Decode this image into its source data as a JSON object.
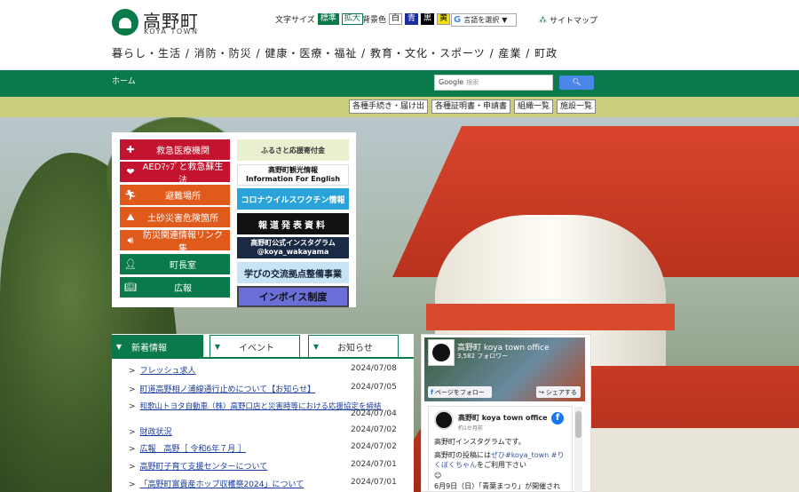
{
  "header": {
    "logo_title": "高野町",
    "logo_sub": "KOYA TOWN",
    "font_size_label": "文字サイズ",
    "font_std": "標準",
    "font_big": "拡大",
    "bg_color_label": "背景色",
    "bg_white": "白",
    "bg_blue": "青",
    "bg_black": "黒",
    "bg_yellow": "黄",
    "translate_label": "言語を選択",
    "sitemap_label": "サイトマップ",
    "nav": "暮らし・生活 / 消防・防災 / 健康・医療・福祉 / 教育・文化・スポーツ / 産業 / 町政"
  },
  "greenbar": {
    "home": "ホーム",
    "search_brand": "Google",
    "search_placeholder": "検索"
  },
  "olive_buttons": [
    "各種手続き・届け出",
    "各種証明書・申請書",
    "組織一覧",
    "施設一覧"
  ],
  "quick_links": [
    {
      "label": "救急医療機関",
      "icon": "cross-icon",
      "color": "#c4132e"
    },
    {
      "label": "AEDﾏｯﾌﾟと救急蘇生法",
      "icon": "heart-icon",
      "color": "#c4132e"
    },
    {
      "label": "避難場所",
      "icon": "running-person-icon",
      "color": "#e05a1c"
    },
    {
      "label": "土砂災害危険箇所",
      "icon": "landslide-icon",
      "color": "#e05a1c"
    },
    {
      "label": "防災関連情報リンク集",
      "icon": "speaker-icon",
      "color": "#e05a1c"
    },
    {
      "label": "町長室",
      "icon": "person-icon",
      "color": "#0b7a4b"
    },
    {
      "label": "広報",
      "icon": "book-icon",
      "color": "#0b7a4b"
    }
  ],
  "banners": {
    "furusato": "ふるさと応援寄付金",
    "kanko_title": "高野町観光情報",
    "kanko_sub": "Information For English",
    "corona": "コロナウイルスワクチン情報",
    "hodo": "報道発表資料",
    "insta_title": "高野町公式インスタグラム",
    "insta_handle": "@koya_wakayama",
    "manabi": "学びの交流拠点整備事業",
    "invoice": "インボイス制度"
  },
  "tabs": [
    "新着情報",
    "イベント",
    "お知らせ"
  ],
  "news": [
    {
      "title": "フレッシュ求人",
      "date": "2024/07/08"
    },
    {
      "title": "町道高野相ノ浦線通行止めについて【お知らせ】",
      "date": "2024/07/05"
    },
    {
      "title": "和歌山トヨタ自動車（株）高野口店と災害時等における応援協定を締結",
      "date": "2024/07/04"
    },
    {
      "title": "財政状況",
      "date": "2024/07/02"
    },
    {
      "title": "広報　高野［ 令和6年７月 ］",
      "date": "2024/07/02"
    },
    {
      "title": "高野町子育て支援センターについて",
      "date": "2024/07/01"
    },
    {
      "title": "「高野町富貴産ホップ収穫祭2024」について",
      "date": "2024/07/01"
    }
  ],
  "facebook": {
    "page_name": "高野町 koya town office",
    "followers": "3,582 フォロワー",
    "follow_label": "ページをフォロー",
    "share_label": "シェアする",
    "post_name": "高野町 koya town office",
    "post_time": "約1か月前",
    "text1": "高野町インスタグラムです。",
    "text2a": "高野町の投稿には",
    "text2link": "ぜひ#koya_town #りくぼくちゃん",
    "text2b": "をご利用下さい",
    "text3": "☺",
    "text4": "6月9日（日）「青葉まつり」が開催され"
  }
}
